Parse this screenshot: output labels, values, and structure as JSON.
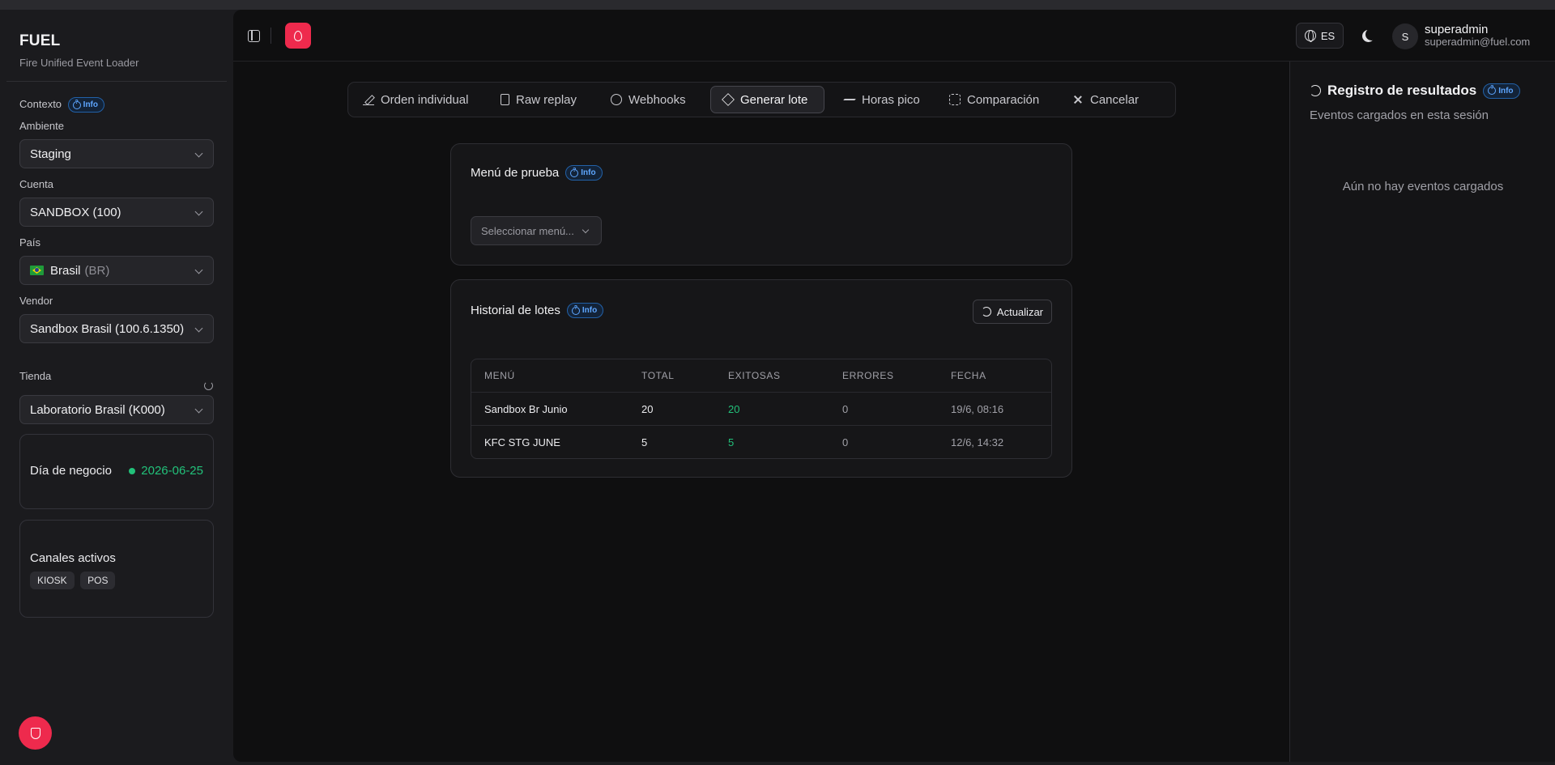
{
  "brand": {
    "name": "FUEL",
    "subtitle": "Fire Unified Event Loader"
  },
  "sidebar": {
    "context_label": "Contexto",
    "info_label": "Info",
    "ambiente": {
      "label": "Ambiente",
      "value": "Staging"
    },
    "cuenta": {
      "label": "Cuenta",
      "value": "SANDBOX (100)"
    },
    "pais": {
      "label": "País",
      "value": "Brasil",
      "code": "(BR)"
    },
    "vendor": {
      "label": "Vendor",
      "value": "Sandbox Brasil (100.6.1350)"
    },
    "tienda": {
      "label": "Tienda",
      "value": "Laboratorio Brasil (K000)"
    },
    "business_day": {
      "label": "Día de negocio",
      "value": "2026-06-25"
    },
    "channels": {
      "label": "Canales activos",
      "items": [
        "KIOSK",
        "POS"
      ]
    }
  },
  "header": {
    "language": "ES",
    "user": {
      "initial": "S",
      "name": "superadmin",
      "email": "superadmin@fuel.com"
    }
  },
  "tabs": [
    {
      "label": "Orden individual",
      "icon": "pencil-icon"
    },
    {
      "label": "Raw replay",
      "icon": "file-icon"
    },
    {
      "label": "Webhooks",
      "icon": "webhook-icon"
    },
    {
      "label": "Generar lote",
      "icon": "layers-icon",
      "active": true
    },
    {
      "label": "Horas pico",
      "icon": "activity-icon"
    },
    {
      "label": "Comparación",
      "icon": "compare-icon"
    },
    {
      "label": "Cancelar",
      "icon": "x-icon"
    }
  ],
  "menu_card": {
    "title": "Menú de prueba",
    "info_label": "Info",
    "select_placeholder": "Seleccionar menú..."
  },
  "history_card": {
    "title": "Historial de lotes",
    "info_label": "Info",
    "refresh_label": "Actualizar",
    "columns": [
      "MENÚ",
      "TOTAL",
      "EXITOSAS",
      "ERRORES",
      "FECHA"
    ],
    "rows": [
      {
        "menu": "Sandbox Br Junio",
        "total": "20",
        "ok": "20",
        "errors": "0",
        "date": "19/6, 08:16"
      },
      {
        "menu": "KFC STG JUNE",
        "total": "5",
        "ok": "5",
        "errors": "0",
        "date": "12/6, 14:32"
      }
    ]
  },
  "results_panel": {
    "title": "Registro de resultados",
    "info_label": "Info",
    "subtitle": "Eventos cargados en esta sesión",
    "empty": "Aún no hay eventos cargados"
  },
  "colors": {
    "accent": "#ee2a4d",
    "success": "#22c17a",
    "info": "#5ea6ff"
  }
}
